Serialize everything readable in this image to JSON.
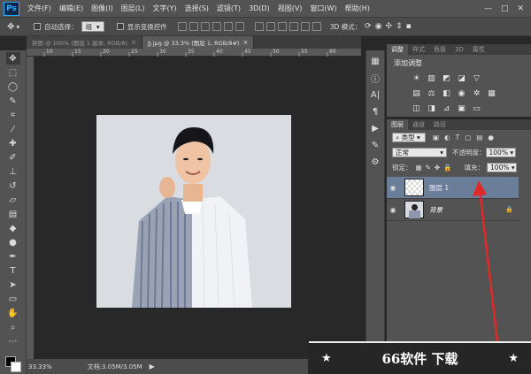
{
  "app": {
    "logo": "Ps"
  },
  "menu": [
    "文件(F)",
    "编辑(E)",
    "图像(I)",
    "图层(L)",
    "文字(Y)",
    "选择(S)",
    "滤镜(T)",
    "3D(D)",
    "视图(V)",
    "窗口(W)",
    "帮助(H)"
  ],
  "window_controls": {
    "minimize": "—",
    "maximize": "□",
    "close": "✕"
  },
  "options_bar": {
    "auto_select_label": "自动选择：",
    "auto_select_value": "组",
    "show_transform_label": "显示变换控件",
    "mode_3d_label": "3D 模式："
  },
  "tabs": [
    {
      "label": "拼图 @ 100% (图层 1 副本, RGB/8)",
      "close": "×"
    },
    {
      "label": "JJ.jpg @ 33.3% (图层 1, RGB/8#)",
      "close": "×"
    }
  ],
  "ruler": {
    "marks": [
      "10",
      "15",
      "20",
      "25",
      "30",
      "35",
      "40",
      "45",
      "50",
      "55",
      "60"
    ]
  },
  "status": {
    "zoom": "33.33%",
    "doc": "文档:3.05M/3.05M"
  },
  "adjustments_panel": {
    "tabs": [
      "调整",
      "样式",
      "色板",
      "3D",
      "属性"
    ],
    "title": "添加调整"
  },
  "layers_panel": {
    "tabs": [
      "图层",
      "通道",
      "路径"
    ],
    "filter_type": "类型",
    "blend_mode": "正常",
    "opacity_label": "不透明度：",
    "opacity_value": "100%",
    "lock_label": "锁定：",
    "fill_label": "填充：",
    "fill_value": "100%",
    "layers": [
      {
        "name": "图层 1",
        "selected": true
      },
      {
        "name": "背景",
        "selected": false
      }
    ]
  },
  "watermark": {
    "text": "66软件 下载",
    "star": "★"
  },
  "colors": {
    "accent_arrow": "#e02a2a",
    "selection": "#6a7e9a",
    "ps_blue": "#31a8ff"
  }
}
